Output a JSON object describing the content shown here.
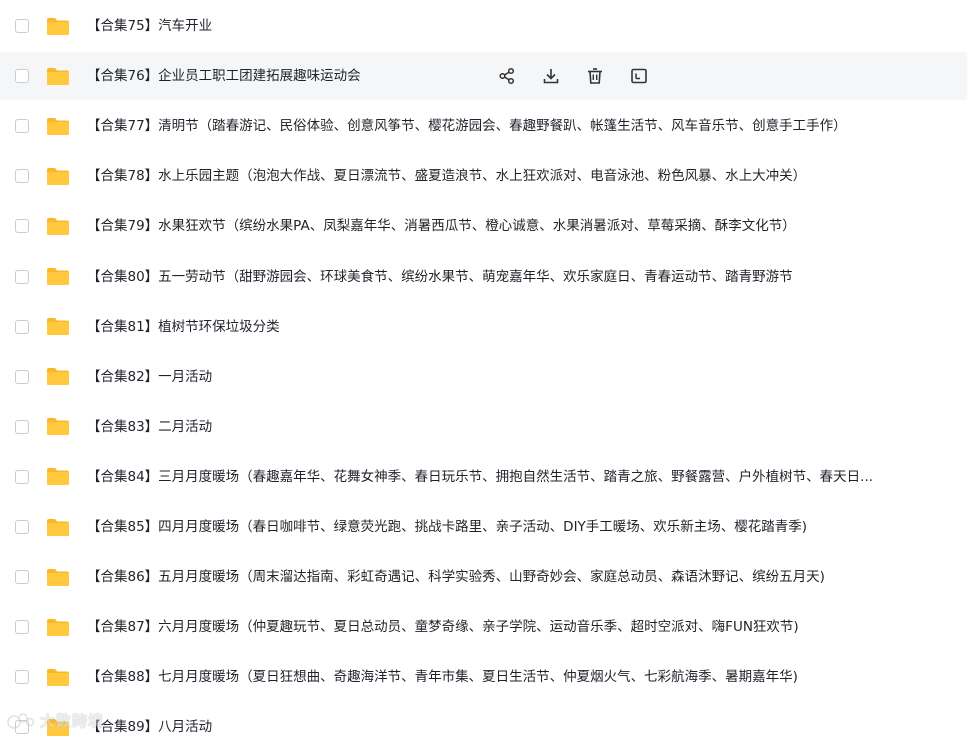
{
  "files": [
    {
      "name": "【合集75】汽车开业"
    },
    {
      "name": "【合集76】企业员工职工团建拓展趣味运动会"
    },
    {
      "name": "【合集77】清明节（踏春游记、民俗体验、创意风筝节、樱花游园会、春趣野餐趴、帐篷生活节、风车音乐节、创意手工手作）"
    },
    {
      "name": "【合集78】水上乐园主题（泡泡大作战、夏日漂流节、盛夏造浪节、水上狂欢派对、电音泳池、粉色风暴、水上大冲关）"
    },
    {
      "name": "【合集79】水果狂欢节（缤纷水果PA、凤梨嘉年华、消暑西瓜节、橙心诚意、水果消暑派对、草莓采摘、酥李文化节）"
    },
    {
      "name": "【合集80】五一劳动节（甜野游园会、环球美食节、缤纷水果节、萌宠嘉年华、欢乐家庭日、青春运动节、踏青野游节"
    },
    {
      "name": "【合集81】植树节环保垃圾分类"
    },
    {
      "name": "【合集82】一月活动"
    },
    {
      "name": "【合集83】二月活动"
    },
    {
      "name": "【合集84】三月月度暖场（春趣嘉年华、花舞女神季、春日玩乐节、拥抱自然生活节、踏青之旅、野餐露营、户外植树节、春天日..."
    },
    {
      "name": "【合集85】四月月度暖场（春日咖啡节、绿意荧光跑、挑战卡路里、亲子活动、DIY手工暖场、欢乐新主场、樱花踏青季)"
    },
    {
      "name": "【合集86】五月月度暖场（周末溜达指南、彩虹奇遇记、科学实验秀、山野奇妙会、家庭总动员、森语沐野记、缤纷五月天)"
    },
    {
      "name": "【合集87】六月月度暖场（仲夏趣玩节、夏日总动员、童梦奇缘、亲子学院、运动音乐季、超时空派对、嗨FUN狂欢节)"
    },
    {
      "name": "【合集88】七月月度暖场（夏日狂想曲、奇趣海洋节、青年市集、夏日生活节、仲夏烟火气、七彩航海季、暑期嘉年华)"
    },
    {
      "name": "【合集89】八月活动"
    }
  ],
  "hover_actions": [
    {
      "icon": "share-icon"
    },
    {
      "icon": "download-icon"
    },
    {
      "icon": "delete-icon"
    },
    {
      "icon": "more-icon"
    }
  ],
  "colors": {
    "folder": "#FFC83D",
    "hover_row": "#f5f6f8",
    "text": "#1f2329"
  },
  "watermark": {
    "text": "大数跨境"
  }
}
